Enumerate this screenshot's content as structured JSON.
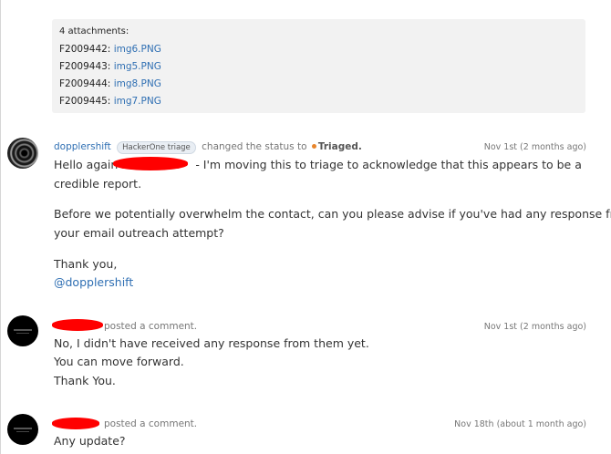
{
  "attachments": {
    "header": "4 attachments:",
    "items": [
      {
        "id": "F2009442:",
        "file": "img6.PNG"
      },
      {
        "id": "F2009443:",
        "file": "img5.PNG"
      },
      {
        "id": "F2009444:",
        "file": "img8.PNG"
      },
      {
        "id": "F2009445:",
        "file": "img7.PNG"
      }
    ]
  },
  "activity1": {
    "user": "dopplershift",
    "badge": "HackerOne triage",
    "action": "changed the status to",
    "status": "Triaged.",
    "date": "Nov 1st (2 months ago)",
    "line1_prefix": "Hello again",
    "line1_suffix": "- I'm moving this to triage to acknowledge that this appears to be a",
    "line2": "credible report.",
    "line3": "Before we potentially overwhelm the contact, can you please advise if you've had any response from",
    "line4": "your email outreach attempt?",
    "line5": "Thank you,",
    "mention": "@dopplershift"
  },
  "activity2": {
    "action": "posted a comment.",
    "date": "Nov 1st (2 months ago)",
    "line1": "No, I didn't have received any response from them yet.",
    "line2": "You can move forward.",
    "line3": "Thank You."
  },
  "activity3": {
    "action": "posted a comment.",
    "date": "Nov 18th (about 1 month ago)",
    "line1": "Any update?"
  },
  "colors": {
    "link": "#2f6fb3",
    "redaction": "#ff0000",
    "status_dot": "#e8852b"
  }
}
